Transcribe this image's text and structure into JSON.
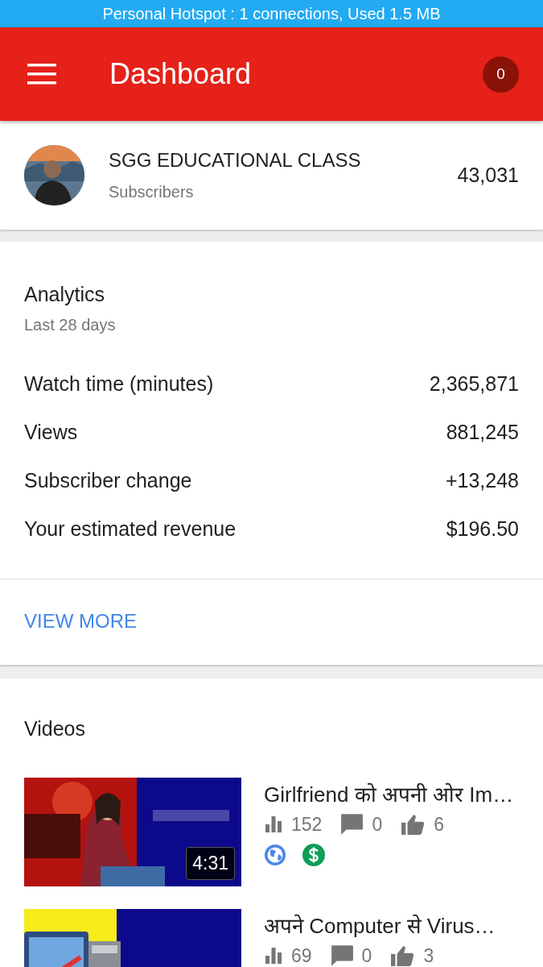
{
  "status_bar": {
    "text": "Personal Hotspot : 1 connections, Used 1.5 MB"
  },
  "app_bar": {
    "title": "Dashboard",
    "notification_count": "0"
  },
  "channel": {
    "name": "SGG EDUCATIONAL CLASS",
    "subtitle": "Subscribers",
    "subscriber_count": "43,031"
  },
  "analytics": {
    "title": "Analytics",
    "period": "Last 28 days",
    "metrics": [
      {
        "label": "Watch time (minutes)",
        "value": "2,365,871"
      },
      {
        "label": "Views",
        "value": "881,245"
      },
      {
        "label": "Subscriber change",
        "value": "+13,248"
      },
      {
        "label": "Your estimated revenue",
        "value": "$196.50"
      }
    ],
    "action": "VIEW MORE"
  },
  "videos": {
    "title": "Videos",
    "items": [
      {
        "title": "Girlfriend को अपनी ओर Im…",
        "duration": "4:31",
        "views": "152",
        "comments": "0",
        "likes": "6",
        "badges": [
          {
            "kind": "public"
          },
          {
            "kind": "monetized"
          }
        ]
      },
      {
        "title": "अपने Computer से Virus…",
        "views": "69",
        "comments": "0",
        "likes": "3"
      }
    ]
  }
}
